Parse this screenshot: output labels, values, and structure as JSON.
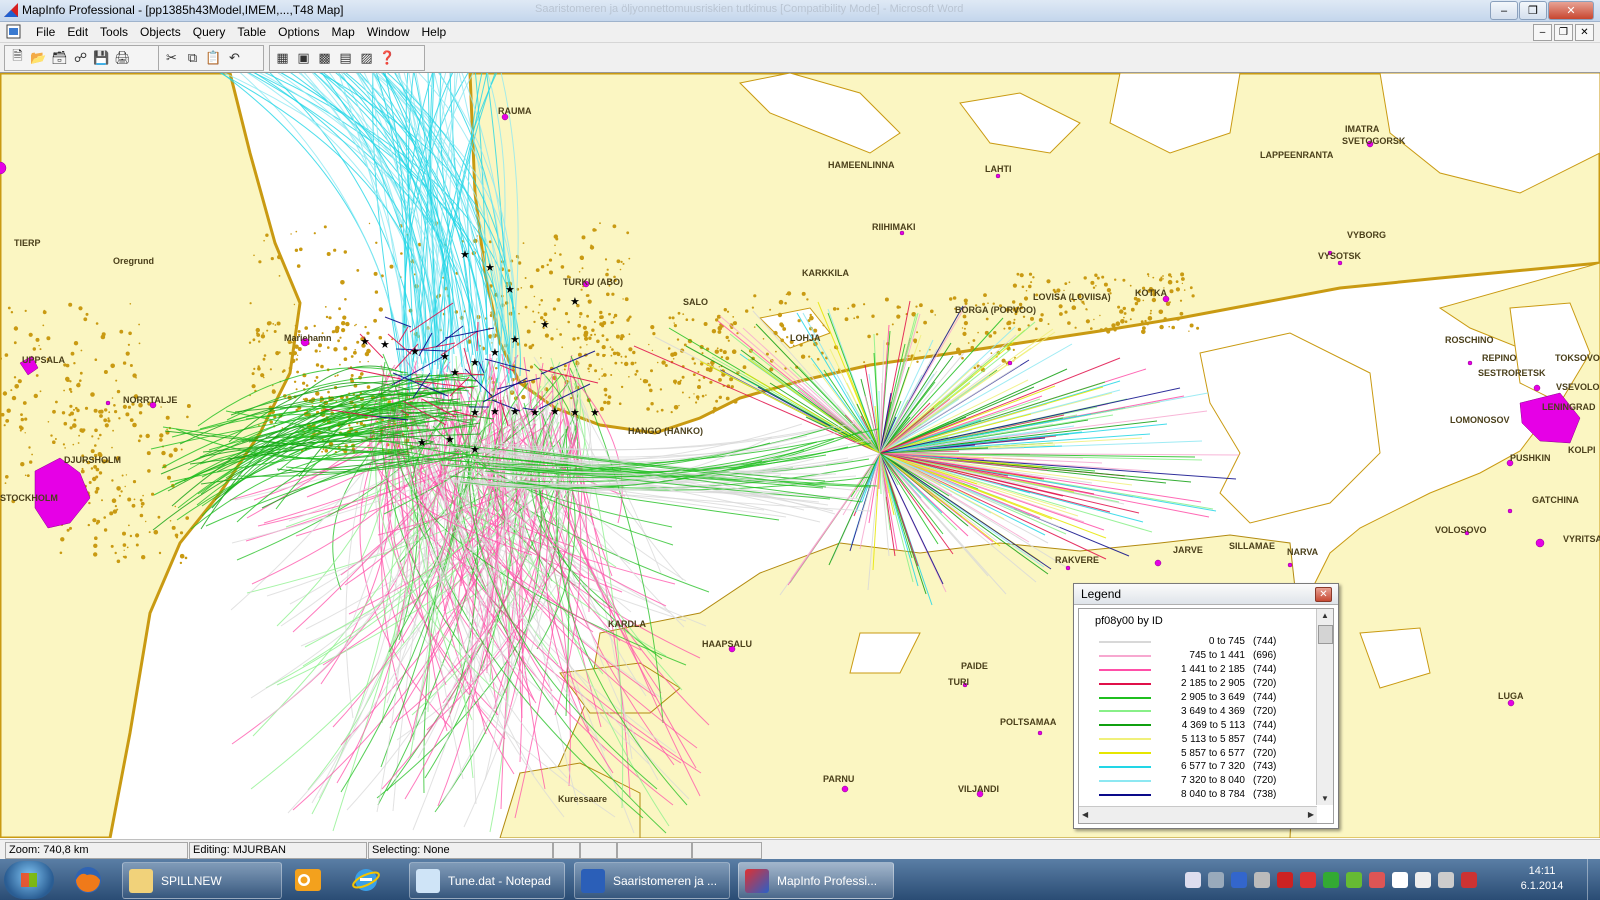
{
  "window": {
    "title": "MapInfo Professional - [pp1385h43Model,IMEM,...,T48 Map]",
    "background_title": "Saaristomeren ja öljyonnettomuusriskien tutkimus [Compatibility Mode] - Microsoft Word"
  },
  "menu": [
    "File",
    "Edit",
    "Tools",
    "Objects",
    "Query",
    "Table",
    "Options",
    "Map",
    "Window",
    "Help"
  ],
  "toolbar_icons": [
    "new-icon",
    "open-icon",
    "open-workspace-icon",
    "open-dbms-icon",
    "save-icon",
    "print-icon",
    "cut-icon",
    "copy-icon",
    "paste-icon",
    "undo-icon",
    "new-browser-icon",
    "new-mapper-icon",
    "new-grapher-icon",
    "new-layout-icon",
    "new-redistrict-icon",
    "help-icon"
  ],
  "map": {
    "places": [
      {
        "name": "RAUMA"
      },
      {
        "name": "HAMEENLINNA"
      },
      {
        "name": "LAHTI"
      },
      {
        "name": "IMATRA"
      },
      {
        "name": "SVETOGORSK"
      },
      {
        "name": "LAPPEENRANTA"
      },
      {
        "name": "RIIHIMAKI"
      },
      {
        "name": "VYBORG"
      },
      {
        "name": "VYSOTSK"
      },
      {
        "name": "TIERP"
      },
      {
        "name": "Oregrund"
      },
      {
        "name": "TURKU (ABO)"
      },
      {
        "name": "KARKKILA"
      },
      {
        "name": "SALO"
      },
      {
        "name": "LOVISA (LOVIISA)"
      },
      {
        "name": "KOTKA"
      },
      {
        "name": "BORGA (PORVOO)"
      },
      {
        "name": "LOHJA"
      },
      {
        "name": "Mariehamn"
      },
      {
        "name": "ROSCHINO"
      },
      {
        "name": "UPPSALA"
      },
      {
        "name": "REPINO"
      },
      {
        "name": "TOKSOVO"
      },
      {
        "name": "SESTRORETSK"
      },
      {
        "name": "VSEVOLO"
      },
      {
        "name": "NORRTALJE"
      },
      {
        "name": "LENINGRAD"
      },
      {
        "name": "LOMONOSOV"
      },
      {
        "name": "HANGO (HANKO)"
      },
      {
        "name": "KOLPI"
      },
      {
        "name": "DJURSHOLM"
      },
      {
        "name": "PUSHKIN"
      },
      {
        "name": "STOCKHOLM"
      },
      {
        "name": "GATCHINA"
      },
      {
        "name": "VOLOSOVO"
      },
      {
        "name": "VYRITSA"
      },
      {
        "name": "RAKVERE"
      },
      {
        "name": "JARVE"
      },
      {
        "name": "SILLAMAE"
      },
      {
        "name": "NARVA"
      },
      {
        "name": "KARDLA"
      },
      {
        "name": "HAAPSALU"
      },
      {
        "name": "PAIDE"
      },
      {
        "name": "TURI"
      },
      {
        "name": "LUGA"
      },
      {
        "name": "POLTSAMAA"
      },
      {
        "name": "PARNU"
      },
      {
        "name": "VILJANDI"
      },
      {
        "name": "Kuressaare"
      }
    ]
  },
  "legend": {
    "window_title": "Legend",
    "heading": "pf08y00 by ID",
    "rows": [
      {
        "range": "0 to    745",
        "count": "(744)",
        "color": "#d8d8d8"
      },
      {
        "range": "745 to 1 441",
        "count": "(696)",
        "color": "#f7a8d0"
      },
      {
        "range": "1 441 to 2 185",
        "count": "(744)",
        "color": "#ff4fa8"
      },
      {
        "range": "2 185 to 2 905",
        "count": "(720)",
        "color": "#e0104a"
      },
      {
        "range": "2 905 to 3 649",
        "count": "(744)",
        "color": "#1fbf1f"
      },
      {
        "range": "3 649 to 4 369",
        "count": "(720)",
        "color": "#88f088"
      },
      {
        "range": "4 369 to 5 113",
        "count": "(744)",
        "color": "#10a010"
      },
      {
        "range": "5 113 to 5 857",
        "count": "(744)",
        "color": "#f0f07a"
      },
      {
        "range": "5 857 to 6 577",
        "count": "(720)",
        "color": "#e6e600"
      },
      {
        "range": "6 577 to 7 320",
        "count": "(743)",
        "color": "#22d6e6"
      },
      {
        "range": "7 320 to 8 040",
        "count": "(720)",
        "color": "#8de8f2"
      },
      {
        "range": "8 040 to 8 784",
        "count": "(738)",
        "color": "#0a0a8a"
      }
    ]
  },
  "status": {
    "zoom": "Zoom: 740,8 km",
    "editing": "Editing: MJURBAN",
    "selecting": "Selecting: None"
  },
  "taskbar": {
    "tasks": [
      {
        "label": "SPILLNEW",
        "icon": "folder-icon"
      },
      {
        "label": "Tune.dat - Notepad",
        "icon": "notepad-icon"
      },
      {
        "label": "Saaristomeren ja ...",
        "icon": "word-icon"
      },
      {
        "label": "MapInfo Professi...",
        "icon": "mapinfo-icon"
      }
    ],
    "time": "14:11",
    "date": "6.1.2014"
  },
  "colors": {
    "land": "#fbf6c2",
    "coast": "#c99a12",
    "city": "#e600e6",
    "taskbar": "#2a4c74"
  }
}
